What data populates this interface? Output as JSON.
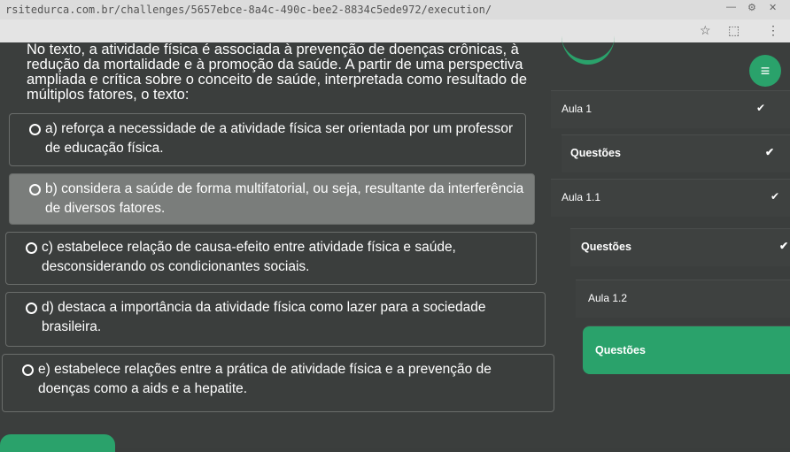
{
  "browser": {
    "url": "rsitedurca.com.br/challenges/5657ebce-8a4c-490c-bee2-8834c5ede972/execution/",
    "min_icon": "minimize-icon",
    "settings_icon": "gear-icon",
    "close_icon": "close-icon"
  },
  "question": {
    "text": "No texto, a atividade física é associada à prevenção de doenças crônicas, à redução da mortalidade e à promoção da saúde. A partir de uma perspectiva ampliada e crítica sobre o conceito de saúde, interpretada como resultado de múltiplos fatores, o texto:"
  },
  "options": [
    {
      "text": "a) reforça a necessidade de a atividade física ser orientada por um professor de educação física.",
      "selected": false
    },
    {
      "text": "b) considera a saúde de forma multifatorial, ou seja, resultante da interferência de diversos fatores.",
      "selected": true
    },
    {
      "text": "c) estabelece relação de causa-efeito entre atividade física e saúde, desconsiderando os condicionantes sociais.",
      "selected": false
    },
    {
      "text": "d) destaca a importância da atividade física como lazer para a sociedade brasileira.",
      "selected": false
    },
    {
      "text": "e) estabelece relações entre a prática de atividade física e a prevenção de doenças como a aids e a hepatite.",
      "selected": false
    }
  ],
  "sidebar": {
    "menu_icon": "≡",
    "items": [
      {
        "label": "Aula 1",
        "type": "lesson",
        "check": "✔"
      },
      {
        "label": "Questões",
        "type": "questions",
        "check": "✔"
      },
      {
        "label": "Aula 1.1",
        "type": "lesson",
        "check": "✔"
      },
      {
        "label": "Questões",
        "type": "questions",
        "check": "✔"
      },
      {
        "label": "Aula 1.2",
        "type": "lesson",
        "check": ""
      },
      {
        "label": "Questões",
        "type": "questions",
        "check": "",
        "active": true
      }
    ]
  },
  "colors": {
    "accent": "#2aa26b",
    "background": "#3b3e3d",
    "selected_option": "#7a7d7b"
  }
}
